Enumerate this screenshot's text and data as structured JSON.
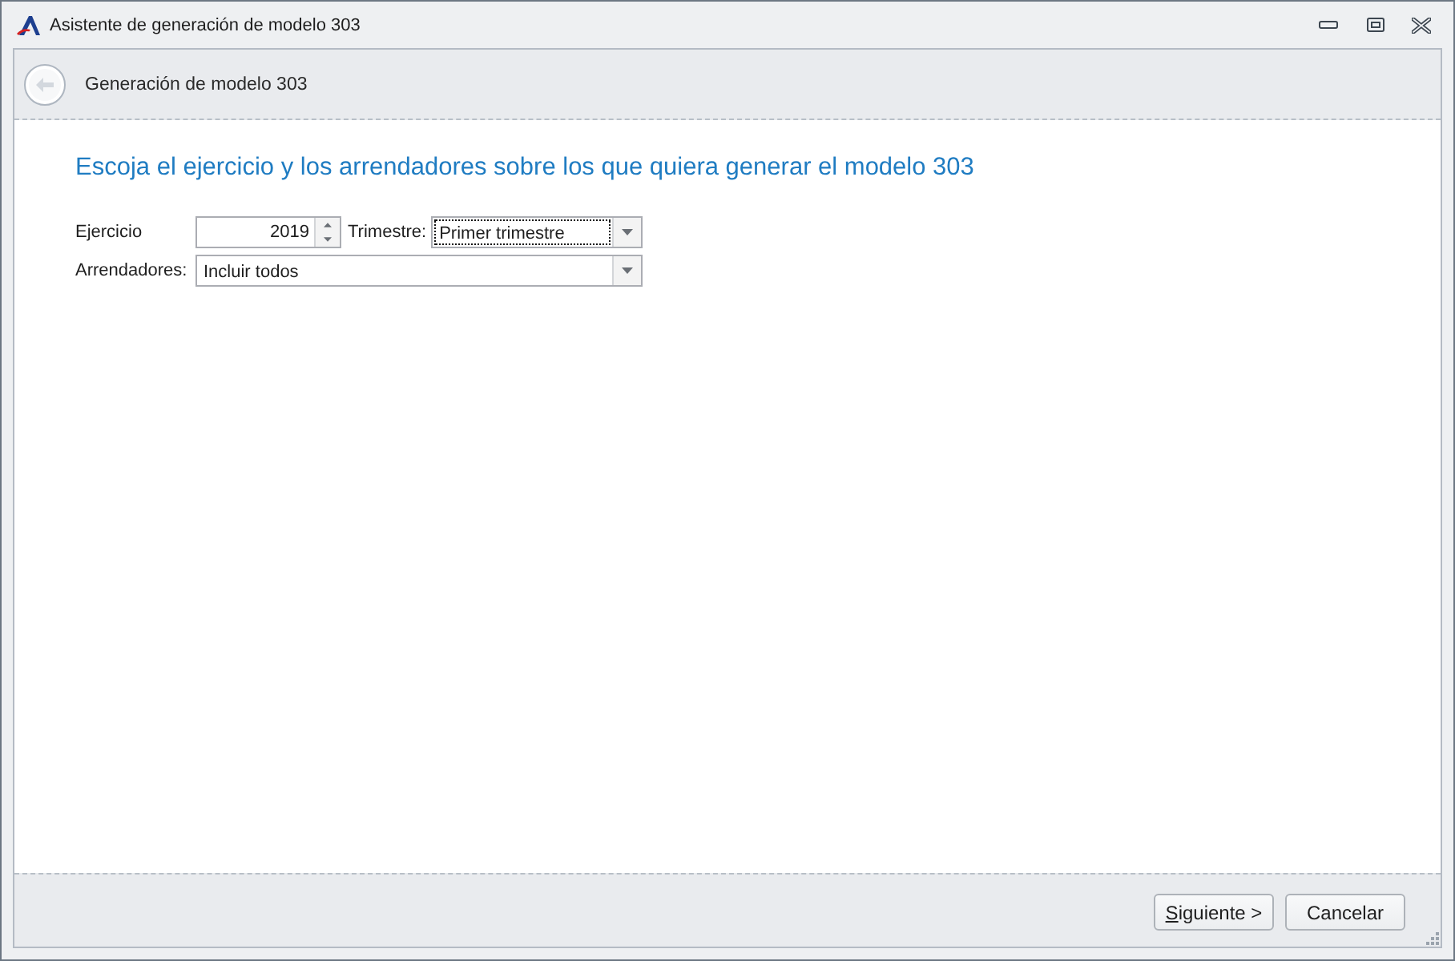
{
  "window": {
    "title": "Asistente de generación de modelo 303"
  },
  "header": {
    "title": "Generación de modelo 303",
    "back_button": {
      "disabled": true
    }
  },
  "content": {
    "heading": "Escoja el ejercicio y los arrendadores sobre los que quiera generar el modelo 303",
    "rows": [
      {
        "label": "Ejercicio",
        "controls": [
          {
            "kind": "spin",
            "value": "2019"
          },
          {
            "kind": "label",
            "text": "Trimestre:"
          },
          {
            "kind": "combo",
            "value": "Primer trimestre",
            "focused": true
          }
        ]
      },
      {
        "label": "Arrendadores:",
        "controls": [
          {
            "kind": "combo",
            "value": "Incluir todos",
            "focused": false
          }
        ]
      }
    ]
  },
  "footer": {
    "buttons": [
      {
        "label": "Siguiente >",
        "access_key_underlined": true
      },
      {
        "label": "Cancelar",
        "access_key_underlined": false
      }
    ]
  }
}
